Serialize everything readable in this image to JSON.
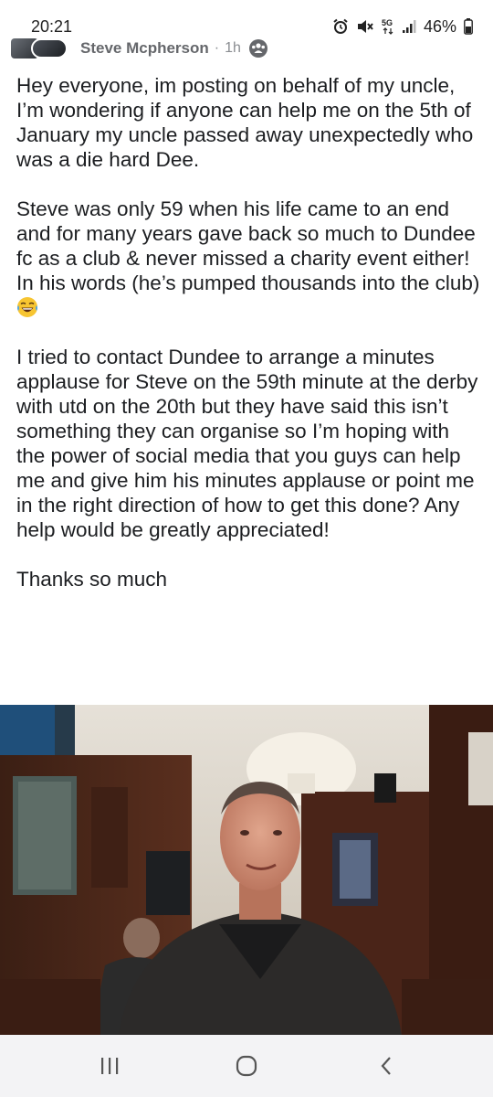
{
  "status_bar": {
    "time": "20:21",
    "network": "5G",
    "battery": "46%",
    "icons": [
      "alarm-icon",
      "mute-icon",
      "network-5g-icon",
      "signal-icon",
      "battery-icon"
    ]
  },
  "post": {
    "author": "Steve Mcpherson",
    "time_ago": "1h",
    "separator": "·",
    "audience_icon": "group-audience-icon",
    "paragraphs": [
      "Hey everyone, im posting on behalf of my uncle, I’m wondering if anyone can help me on the 5th of January my uncle passed away unexpectedly who was a die hard Dee.",
      "Steve was only 59 when his life came to an end and for many years gave back so much to Dundee fc as a club & never missed a charity event either! In his words (he’s pumped thousands into the club)",
      "I tried to contact Dundee to arrange a minutes applause for Steve on the 59th minute at the derby with utd on the 20th but they have said this isn’t something they can organise so I’m hoping with the power of social media that you guys can help me and give him his minutes applause or point me in the right direction of how to get this done? Any help would be greatly appreciated!",
      "Thanks so much"
    ],
    "emoji": "laughing-crying-emoji",
    "photo": "photo-man-in-pub"
  },
  "nav_bar": {
    "icons": [
      "recent-apps-icon",
      "home-icon",
      "back-icon"
    ]
  },
  "colors": {
    "text": "#1c1e21",
    "meta": "#65676b",
    "nav_background": "#f3f3f5"
  }
}
